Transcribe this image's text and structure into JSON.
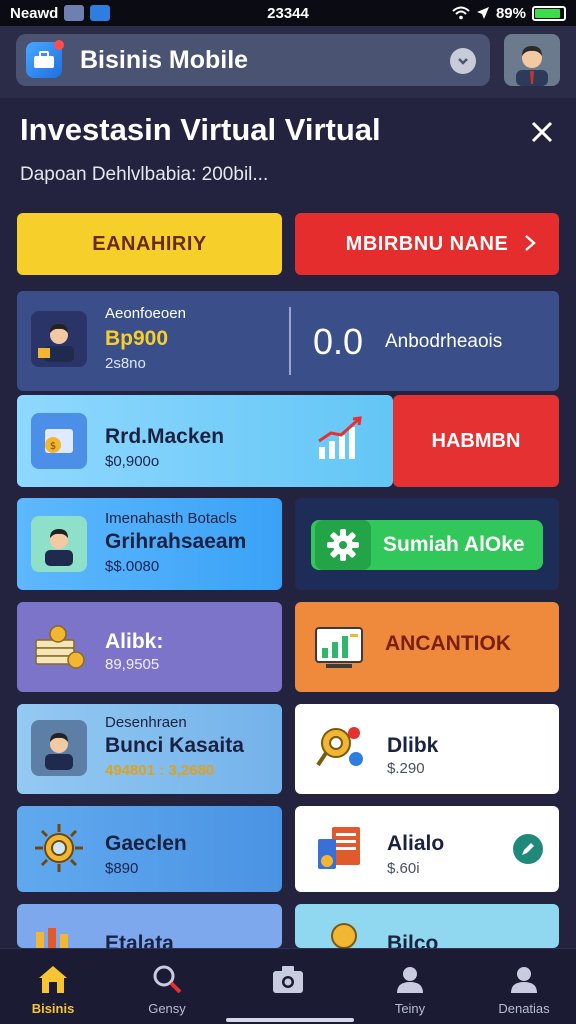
{
  "status_bar": {
    "carrier": "Neawd",
    "time": "23344",
    "battery": "89%",
    "battery_level": 0.89
  },
  "header": {
    "app_title": "Bisinis Mobile",
    "logo_icon": "briefcase-icon",
    "avatar": "user-avatar"
  },
  "page": {
    "title": "Investasin Virtual Virtual",
    "subtitle": "Dapoan Dehlvlbabia: 200bil...",
    "close_icon": "close-icon"
  },
  "actions": {
    "primary_label": "EANAHIRIY",
    "secondary_label": "MBIRBNU NANE"
  },
  "balance": {
    "label": "Aeonfoeoen",
    "amount": "Bp900",
    "sub": "2s8no",
    "value": "0.0",
    "side_label": "Anbodrheaois"
  },
  "cards": [
    {
      "title": "Rrd.Macken",
      "sub": "$0,900o",
      "action": "HABMBN"
    },
    {
      "label": "Imenahasth Botacls",
      "title": "Grihrahsaeam",
      "sub": "$$.0080",
      "button": "Sumiah AlOke"
    },
    {
      "title": "Alibk:",
      "sub": "89,9505",
      "right_title": "ANCANTIOK"
    },
    {
      "label": "Desenhraen",
      "title": "Bunci Kasaita",
      "sub": "494801 : 3,2680",
      "right_title": "Dlibk",
      "right_sub": "$.290"
    },
    {
      "title": "Gaeclen",
      "sub": "$890",
      "right_title": "Alialo",
      "right_sub": "$.60i"
    },
    {
      "title": "Etalata",
      "right_title": "Bilco"
    }
  ],
  "bottom_nav": [
    {
      "label": "Bisinis",
      "icon": "home-icon",
      "active": true
    },
    {
      "label": "Gensy",
      "icon": "search-icon",
      "active": false
    },
    {
      "label": "",
      "icon": "camera-icon",
      "active": false
    },
    {
      "label": "Teiny",
      "icon": "profile-icon",
      "active": false
    },
    {
      "label": "Denatias",
      "icon": "account-icon",
      "active": false
    }
  ],
  "colors": {
    "background": "#23233f",
    "primary_yellow": "#f7cf2b",
    "primary_red": "#e52d2d",
    "success_green": "#32c75a",
    "accent_orange": "#ef8a3c",
    "nav_active": "#f7c531"
  }
}
